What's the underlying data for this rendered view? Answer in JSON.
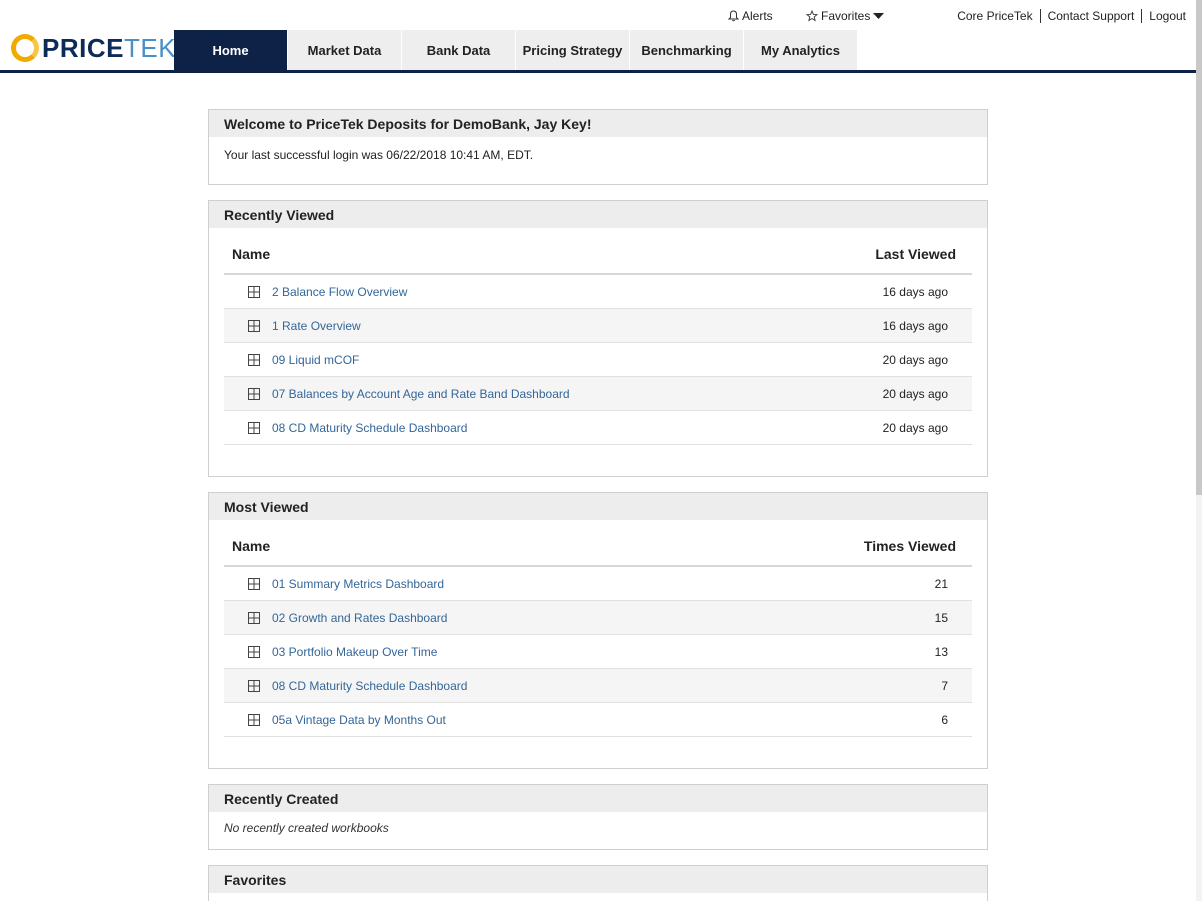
{
  "header": {
    "alerts_label": "Alerts",
    "favorites_label": "Favorites",
    "links": [
      "Core PriceTek",
      "Contact Support",
      "Logout"
    ]
  },
  "logo": {
    "part1": "PRICE",
    "part2": "TEK"
  },
  "nav": {
    "tabs": [
      "Home",
      "Market Data",
      "Bank Data",
      "Pricing Strategy",
      "Benchmarking",
      "My Analytics"
    ],
    "active": "Home"
  },
  "welcome": {
    "title": "Welcome to PriceTek Deposits for DemoBank, Jay Key!",
    "message": "Your last successful login was 06/22/2018 10:41 AM, EDT."
  },
  "recently_viewed": {
    "title": "Recently Viewed",
    "col_name": "Name",
    "col_value": "Last Viewed",
    "rows": [
      {
        "name": "2 Balance Flow Overview",
        "value": "16 days ago"
      },
      {
        "name": "1 Rate Overview",
        "value": "16 days ago"
      },
      {
        "name": "09 Liquid mCOF",
        "value": "20 days ago"
      },
      {
        "name": "07 Balances by Account Age and Rate Band Dashboard",
        "value": "20 days ago"
      },
      {
        "name": "08 CD Maturity Schedule Dashboard",
        "value": "20 days ago"
      }
    ]
  },
  "most_viewed": {
    "title": "Most Viewed",
    "col_name": "Name",
    "col_value": "Times Viewed",
    "rows": [
      {
        "name": "01 Summary Metrics Dashboard",
        "value": "21"
      },
      {
        "name": "02 Growth and Rates Dashboard",
        "value": "15"
      },
      {
        "name": "03 Portfolio Makeup Over Time",
        "value": "13"
      },
      {
        "name": "08 CD Maturity Schedule Dashboard",
        "value": "7"
      },
      {
        "name": "05a Vintage Data by Months Out",
        "value": "6"
      }
    ]
  },
  "recently_created": {
    "title": "Recently Created",
    "empty": "No recently created workbooks"
  },
  "favorites": {
    "title": "Favorites"
  },
  "colors": {
    "nav_active": "#0d2246",
    "link": "#336699",
    "logo_ring": "#f2a900"
  }
}
